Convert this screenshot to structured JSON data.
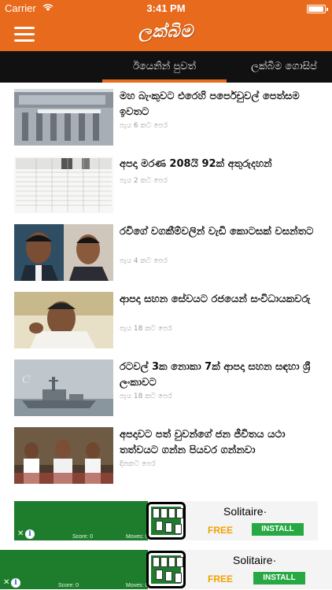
{
  "status_bar": {
    "carrier": "Carrier",
    "time": "3:41 PM",
    "battery_level": 1.0
  },
  "header": {
    "logo_text": "ලක්බිම",
    "menu_icon": "hamburger-icon"
  },
  "tabs": [
    {
      "label": "ඊයෙනින් පුවත්",
      "active": true
    },
    {
      "label": "ලක්බිම ගොසිප්",
      "active": false
    }
  ],
  "news": [
    {
      "headline": "මහ බැංකුවට එරෙහි පර්පෙචුවල් පෙත්සම ඉවතට",
      "time": "පැය 6 කට පෙර",
      "thumb": "central-bank-building"
    },
    {
      "headline": "අපදා මරණ 208යි 92ක් අතුරුදහන්",
      "time": "පැය 2 කට පෙර",
      "thumb": "data-table-document"
    },
    {
      "headline": "රවිගේ වගකීම්වලින් වැඩි කොටසක් වසන්තට",
      "time": "පැය 4 කට පෙර",
      "thumb": "two-politicians-portrait"
    },
    {
      "headline": "ආපදා සහන සේවයට රජයෙන් සංවිධායකවරු",
      "time": "පැය 18 කට පෙර",
      "thumb": "president-speaking"
    },
    {
      "headline": "රටවල් 3ක නොකා 7ක් ආපදා සහන සඳහා ශ්‍රී ලංකාවට",
      "time": "පැය 18 කට පෙර",
      "thumb": "navy-ship"
    },
    {
      "headline": "අපදාවට පත් වුවන්ගේ ජන ජීවිතය යථා තත්වයට ගන්න පියවර ගන්නවා",
      "time": "දිනකට පෙර",
      "thumb": "officials-meeting"
    }
  ],
  "ads": [
    {
      "title": "Solitaire·",
      "free_label": "FREE",
      "install_label": "INSTALL",
      "score_label": "Score: 0",
      "moves_label": "Moves: 0"
    },
    {
      "title": "Solitaire·",
      "free_label": "FREE",
      "install_label": "INSTALL",
      "score_label": "Score: 0",
      "moves_label": "Moves: 0"
    }
  ],
  "colors": {
    "brand_orange": "#e86a1c",
    "tab_bar": "#111111",
    "time_gray": "#9a9a9a",
    "install_green": "#26a843",
    "free_orange": "#f4a000"
  }
}
